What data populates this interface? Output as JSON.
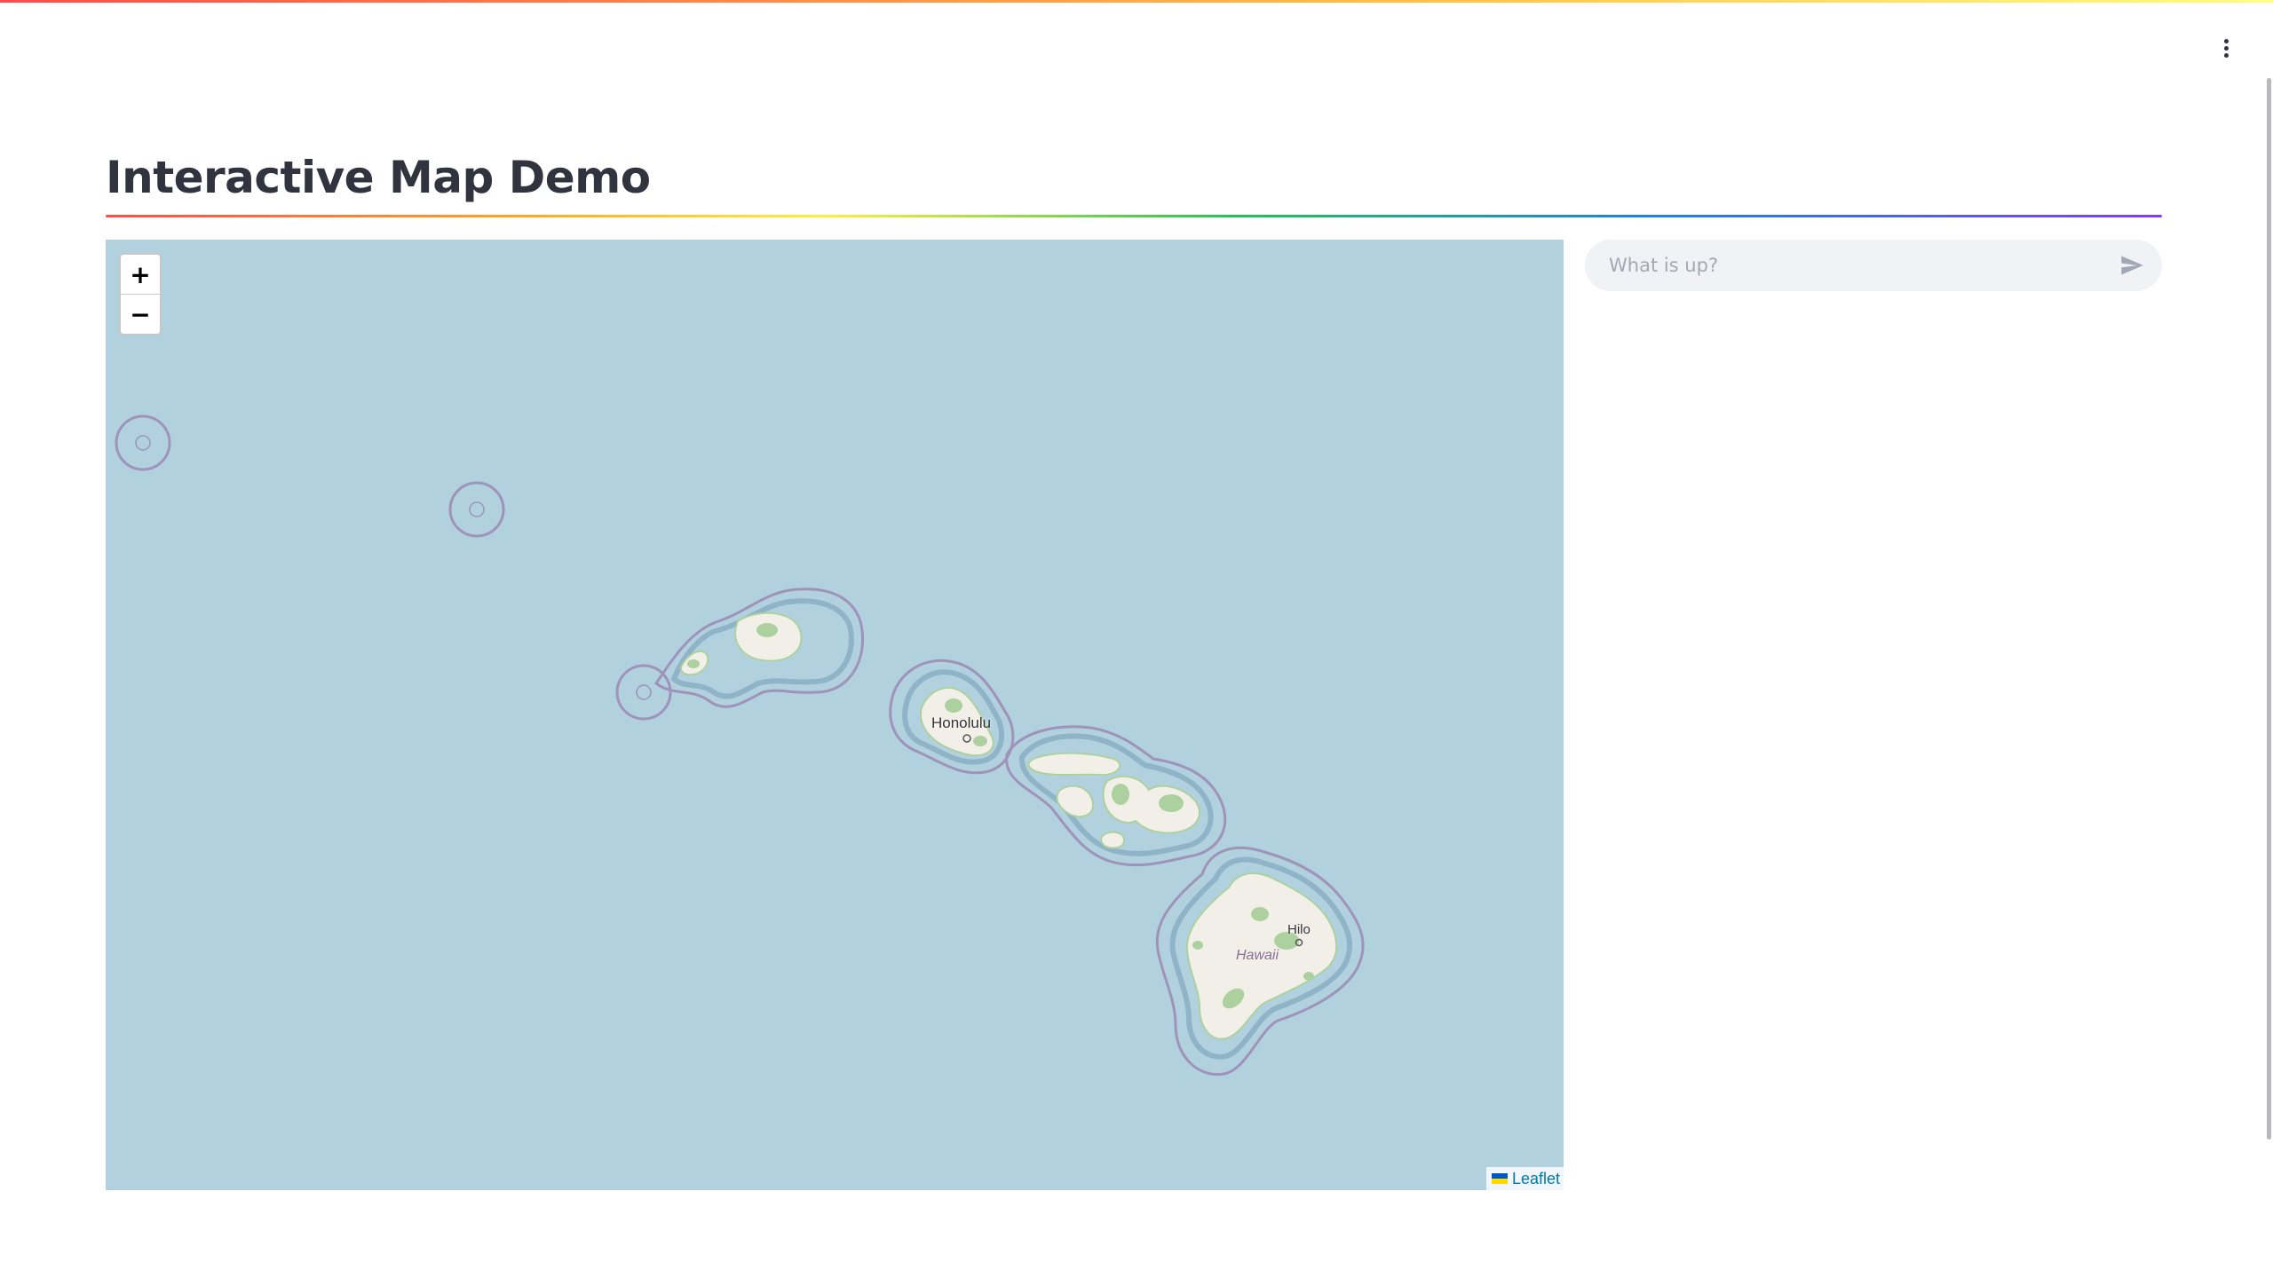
{
  "page": {
    "title": "Interactive Map Demo"
  },
  "header": {
    "menu_icon": "kebab-menu-icon"
  },
  "map": {
    "zoom_in_label": "+",
    "zoom_out_label": "−",
    "attribution_label": "Leaflet",
    "attribution_icon": "ukraine-flag-icon",
    "labels": {
      "honolulu": "Honolulu",
      "hilo": "Hilo",
      "hawaii": "Hawaii"
    },
    "colors": {
      "water": "#b2d1de",
      "land": "#f2efe9",
      "vegetation": "#add19e",
      "boundary": "#9e93b8"
    }
  },
  "chat": {
    "placeholder": "What is up?",
    "send_icon": "send-icon"
  }
}
